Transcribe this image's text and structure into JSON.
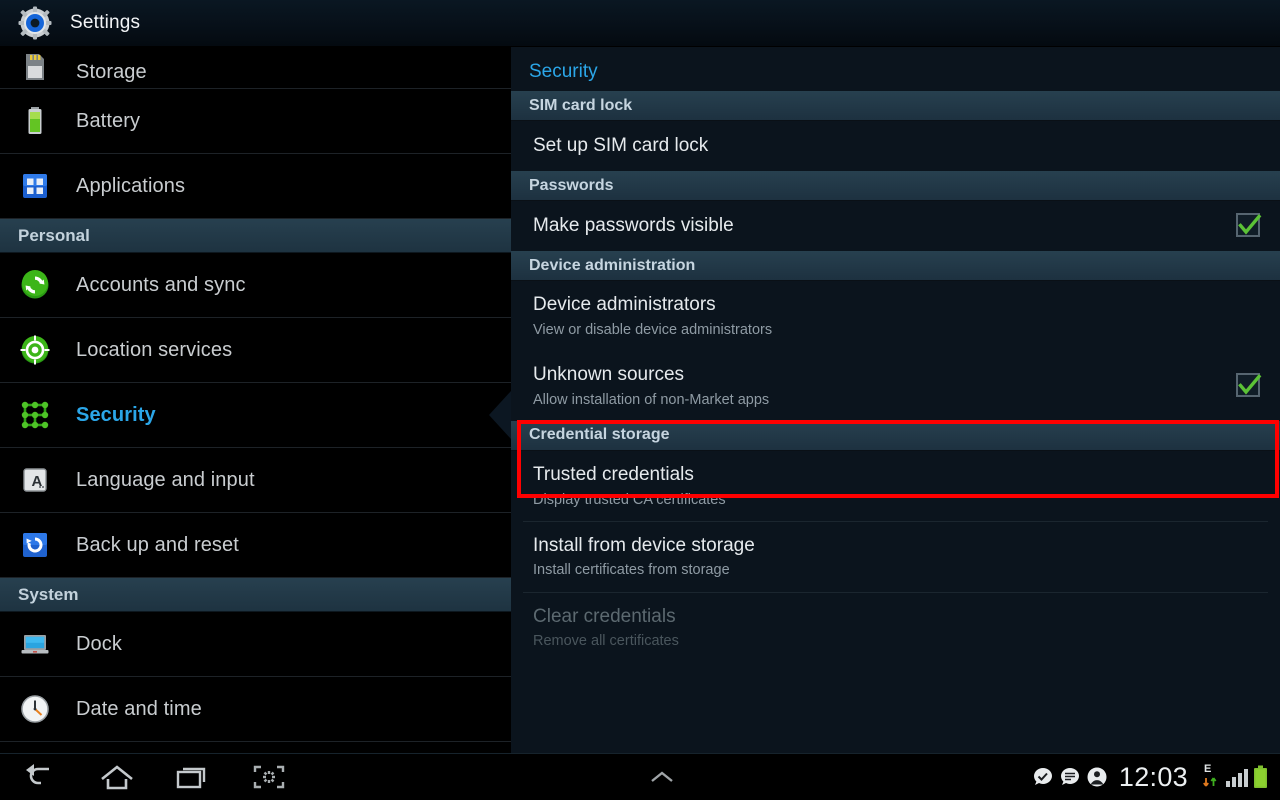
{
  "appbar": {
    "title": "Settings",
    "icon": "settings-gear-icon"
  },
  "sidebar": {
    "items": [
      {
        "label": "Storage",
        "icon": "sd-card-icon",
        "type": "item",
        "selected": false,
        "partial": true
      },
      {
        "label": "Battery",
        "icon": "battery-icon",
        "type": "item",
        "selected": false
      },
      {
        "label": "Applications",
        "icon": "apps-grid-icon",
        "type": "item",
        "selected": false
      },
      {
        "label": "Personal",
        "icon": "",
        "type": "header"
      },
      {
        "label": "Accounts and sync",
        "icon": "sync-circle-icon",
        "type": "item",
        "selected": false
      },
      {
        "label": "Location services",
        "icon": "location-target-icon",
        "type": "item",
        "selected": false
      },
      {
        "label": "Security",
        "icon": "pattern-lock-icon",
        "type": "item",
        "selected": true
      },
      {
        "label": "Language and input",
        "icon": "keyboard-a-icon",
        "type": "item",
        "selected": false
      },
      {
        "label": "Back up and reset",
        "icon": "restore-arrow-icon",
        "type": "item",
        "selected": false
      },
      {
        "label": "System",
        "icon": "",
        "type": "header"
      },
      {
        "label": "Dock",
        "icon": "dock-laptop-icon",
        "type": "item",
        "selected": false
      },
      {
        "label": "Date and time",
        "icon": "clock-icon",
        "type": "item",
        "selected": false,
        "partial": true
      }
    ]
  },
  "content": {
    "title": "Security",
    "sections": [
      {
        "header": "SIM card lock",
        "rows": [
          {
            "title": "Set up SIM card lock",
            "sub": "",
            "checkbox": null,
            "disabled": false,
            "highlighted": false
          }
        ]
      },
      {
        "header": "Passwords",
        "rows": [
          {
            "title": "Make passwords visible",
            "sub": "",
            "checkbox": true,
            "disabled": false,
            "highlighted": false
          }
        ]
      },
      {
        "header": "Device administration",
        "rows": [
          {
            "title": "Device administrators",
            "sub": "View or disable device administrators",
            "checkbox": null,
            "disabled": false,
            "highlighted": false
          },
          {
            "title": "Unknown sources",
            "sub": "Allow installation of non-Market apps",
            "checkbox": true,
            "disabled": false,
            "highlighted": true
          }
        ]
      },
      {
        "header": "Credential storage",
        "rows": [
          {
            "title": "Trusted credentials",
            "sub": "Display trusted CA certificates",
            "checkbox": null,
            "disabled": false,
            "highlighted": false
          },
          {
            "title": "Install from device storage",
            "sub": "Install certificates from storage",
            "checkbox": null,
            "disabled": false,
            "highlighted": false
          },
          {
            "title": "Clear credentials",
            "sub": "Remove all certificates",
            "checkbox": null,
            "disabled": true,
            "highlighted": false
          }
        ]
      }
    ]
  },
  "systembar": {
    "nav": [
      {
        "name": "back-icon",
        "label": "Back"
      },
      {
        "name": "home-icon",
        "label": "Home"
      },
      {
        "name": "recents-icon",
        "label": "Recent apps"
      },
      {
        "name": "screenshot-icon",
        "label": "Screen capture"
      }
    ],
    "center_icon": "chevron-up-icon",
    "notifications": [
      {
        "name": "check-bubble-icon"
      },
      {
        "name": "message-bubble-icon"
      },
      {
        "name": "account-bubble-icon"
      }
    ],
    "clock": "12:03",
    "data_indicator": "E",
    "signal_icon": "signal-bars-icon",
    "battery_icon": "battery-full-icon"
  },
  "colors": {
    "accent": "#2ba6e8",
    "highlight_box": "#ff0000",
    "check_green": "#5bc236",
    "section_header_bg": "#27404f",
    "panel_bg": "#0b141d"
  }
}
